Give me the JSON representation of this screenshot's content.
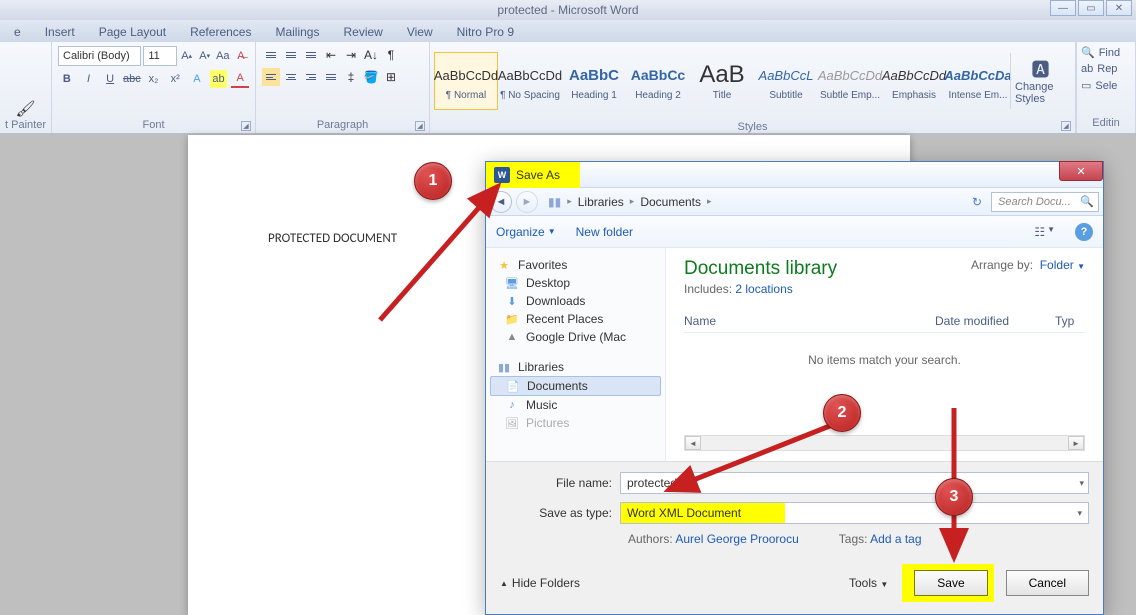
{
  "window": {
    "title": "protected - Microsoft Word"
  },
  "ribbon_tabs": [
    "e",
    "Insert",
    "Page Layout",
    "References",
    "Mailings",
    "Review",
    "View",
    "Nitro Pro 9"
  ],
  "font": {
    "name": "Calibri (Body)",
    "size": "11"
  },
  "ribbon_groups": {
    "clipboard": "t Painter",
    "font": "Font",
    "paragraph": "Paragraph",
    "styles": "Styles",
    "editing": "Editin"
  },
  "styles_gallery": [
    {
      "sample": "AaBbCcDd",
      "name": "¶ Normal",
      "cls": "normal selected"
    },
    {
      "sample": "AaBbCcDd",
      "name": "¶ No Spacing",
      "cls": "nospacing"
    },
    {
      "sample": "AaBbC",
      "name": "Heading 1",
      "cls": "h1"
    },
    {
      "sample": "AaBbCc",
      "name": "Heading 2",
      "cls": "h2"
    },
    {
      "sample": "AaB",
      "name": "Title",
      "cls": "title-s"
    },
    {
      "sample": "AaBbCcL",
      "name": "Subtitle",
      "cls": "subtitle"
    },
    {
      "sample": "AaBbCcDd",
      "name": "Subtle Emp...",
      "cls": "subemph"
    },
    {
      "sample": "AaBbCcDd",
      "name": "Emphasis",
      "cls": "emph"
    },
    {
      "sample": "AaBbCcDa",
      "name": "Intense Em...",
      "cls": "intense"
    }
  ],
  "change_styles_label": "Change Styles",
  "editing_items": [
    "Find",
    "Rep",
    "Sele"
  ],
  "document_text": "PROTECTED DOCUMENT",
  "dialog": {
    "title": "Save As",
    "breadcrumb": [
      "Libraries",
      "Documents"
    ],
    "search_placeholder": "Search Docu...",
    "toolbar": {
      "organize": "Organize",
      "new_folder": "New folder"
    },
    "tree": {
      "favorites": "Favorites",
      "desktop": "Desktop",
      "downloads": "Downloads",
      "recent": "Recent Places",
      "gdrive": "Google Drive (Mac",
      "libraries": "Libraries",
      "documents": "Documents",
      "music": "Music",
      "pictures": "Pictures"
    },
    "main": {
      "heading": "Documents library",
      "includes_label": "Includes:",
      "includes_link": "2 locations",
      "arrange_label": "Arrange by:",
      "arrange_value": "Folder",
      "col_name": "Name",
      "col_date": "Date modified",
      "col_type": "Typ",
      "empty": "No items match your search."
    },
    "fields": {
      "file_name_label": "File name:",
      "file_name_value": "protected",
      "save_type_label": "Save as type:",
      "save_type_value": "Word XML Document",
      "authors_label": "Authors:",
      "authors_value": "Aurel George Proorocu",
      "tags_label": "Tags:",
      "tags_value": "Add a tag"
    },
    "buttons": {
      "hide": "Hide Folders",
      "tools": "Tools",
      "save": "Save",
      "cancel": "Cancel"
    }
  },
  "callouts": {
    "c1": "1",
    "c2": "2",
    "c3": "3"
  }
}
